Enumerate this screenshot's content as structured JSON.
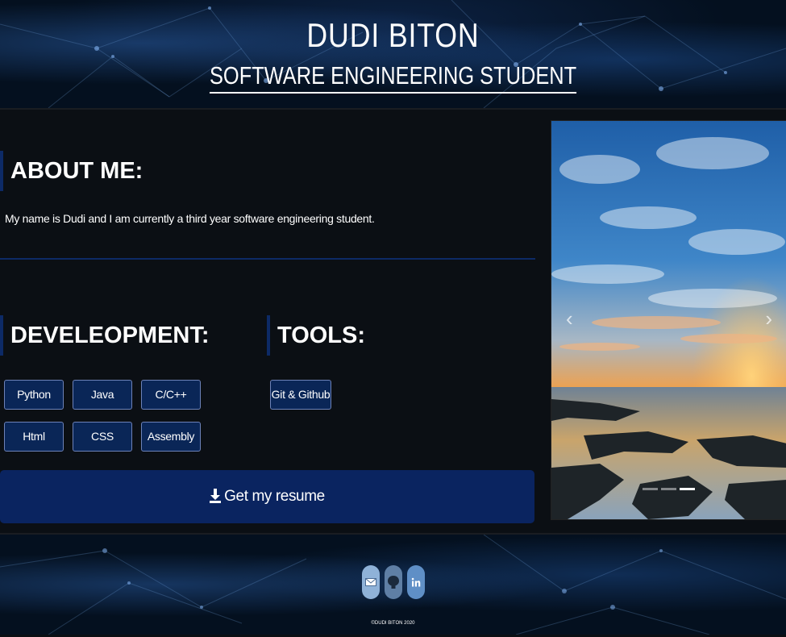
{
  "header": {
    "name": "DUDI BITON",
    "subtitle": "SOFTWARE ENGINEERING STUDENT"
  },
  "about": {
    "heading": "ABOUT ME:",
    "text": "My name is Dudi and I am currently a third year software engineering student."
  },
  "development": {
    "heading": "DEVELEOPMENT:",
    "skills": [
      "Python",
      "Java",
      "C/C++",
      "Html",
      "CSS",
      "Assembly"
    ]
  },
  "tools": {
    "heading": "TOOLS:",
    "items": [
      "Git & Github"
    ]
  },
  "resume_button": {
    "label": "Get my resume",
    "icon": "download-icon"
  },
  "carousel": {
    "image": "sunset-seashore-rocks",
    "slide_count": 3,
    "active_slide": 3
  },
  "footer": {
    "icons": [
      "email-icon",
      "github-icon",
      "linkedin-icon"
    ],
    "copyright": "©DUDI BITON 2020"
  },
  "colors": {
    "accent": "#0a2460",
    "divider": "#0d2a66",
    "background": "#0b0f14"
  }
}
